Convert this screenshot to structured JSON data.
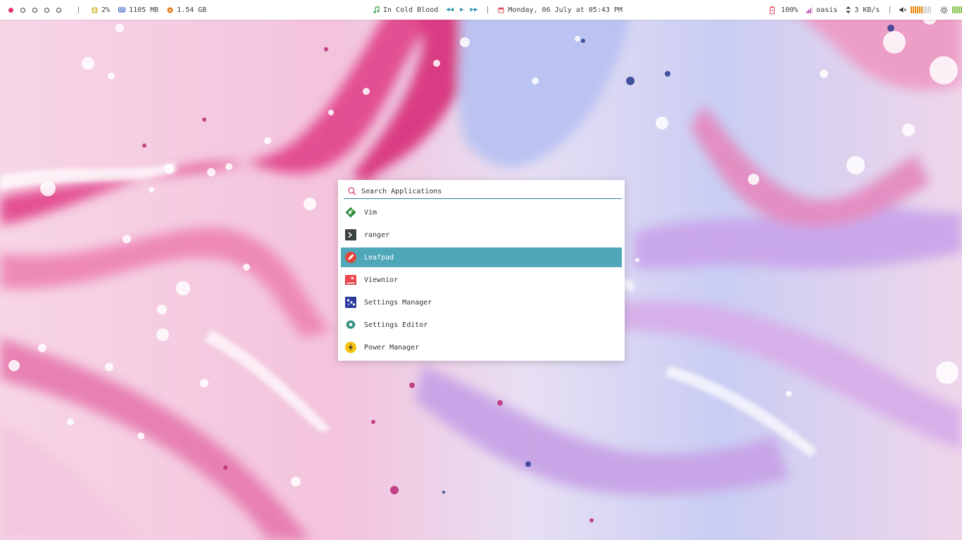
{
  "topbar": {
    "workspaces": [
      {
        "active": true
      },
      {
        "active": false
      },
      {
        "active": false
      },
      {
        "active": false
      },
      {
        "active": false
      }
    ],
    "cpu": {
      "icon": "cpu-icon",
      "value": "2%"
    },
    "memory": {
      "icon": "memory-icon",
      "value": "1105 MB"
    },
    "disk": {
      "icon": "disk-icon",
      "value": "1.54 GB"
    },
    "music": {
      "icon": "music-note-icon",
      "track": "In Cold Blood"
    },
    "date": {
      "icon": "calendar-icon",
      "text": "Monday, 06 July at 05:43 PM"
    },
    "battery": {
      "icon": "battery-icon",
      "value": "100%"
    },
    "wifi": {
      "icon": "wifi-signal-icon",
      "ssid": "oasis"
    },
    "network": {
      "icon": "updown-arrows-icon",
      "speed": "3 KB/s"
    },
    "volume": {
      "icon": "speaker-muted-icon",
      "level": 0.6
    },
    "brightness": {
      "icon": "brightness-icon",
      "level": 0.9
    }
  },
  "launcher": {
    "search": {
      "placeholder": "Search Applications",
      "value": ""
    },
    "apps": [
      {
        "label": "Vim",
        "icon": "vim-icon",
        "selected": false
      },
      {
        "label": "ranger",
        "icon": "terminal-icon",
        "selected": false
      },
      {
        "label": "Leafpad",
        "icon": "leafpad-icon",
        "selected": true
      },
      {
        "label": "Viewnior",
        "icon": "image-viewer-icon",
        "selected": false
      },
      {
        "label": "Settings Manager",
        "icon": "settings-manager-icon",
        "selected": false
      },
      {
        "label": "Settings Editor",
        "icon": "settings-editor-icon",
        "selected": false
      },
      {
        "label": "Power Manager",
        "icon": "power-manager-icon",
        "selected": false
      }
    ]
  },
  "colors": {
    "accent": "#4ea8b8",
    "workspace_active": "#e2336c",
    "media_controls": "#2a8fb0",
    "volume_bars": "#e8890c",
    "brightness_bars": "#7bc043"
  }
}
